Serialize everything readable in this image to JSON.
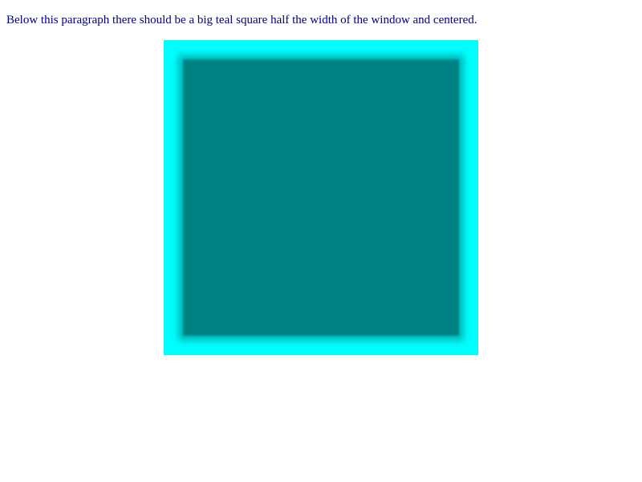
{
  "paragraph": {
    "text": "Below this paragraph there should be a big teal square half the width of the window and centered."
  },
  "colors": {
    "text": "#000080",
    "square_outer": "#00ffff",
    "square_inner": "#008080",
    "background": "#ffffff"
  }
}
